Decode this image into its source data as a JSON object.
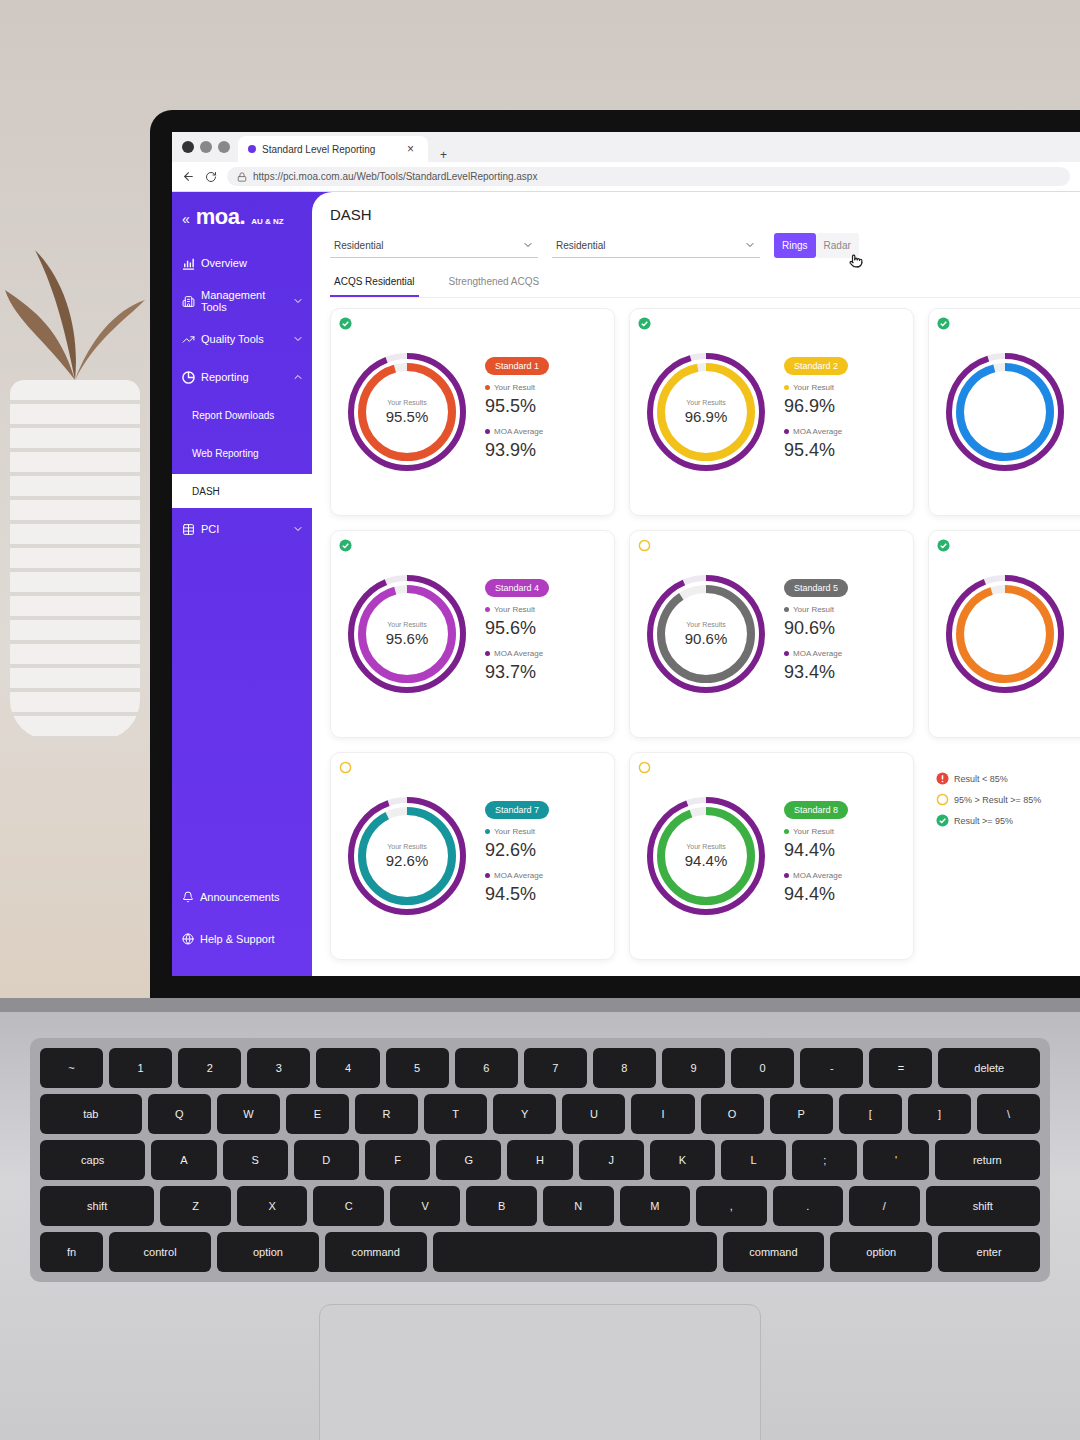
{
  "browser": {
    "tab_title": "Standard Level Reporting",
    "tab_close": "×",
    "new_tab": "+",
    "url": "https://pci.moa.com.au/Web/Tools/StandardLevelReporting.aspx"
  },
  "sidebar": {
    "collapse": "«",
    "logo": "moa.",
    "logo_region": "AU & NZ",
    "items": [
      {
        "label": "Overview",
        "kind": "section",
        "expandable": false,
        "expanded": false,
        "selected": false
      },
      {
        "label": "Management Tools",
        "kind": "section",
        "expandable": true,
        "expanded": false,
        "selected": false
      },
      {
        "label": "Quality Tools",
        "kind": "section",
        "expandable": true,
        "expanded": false,
        "selected": false
      },
      {
        "label": "Reporting",
        "kind": "section",
        "expandable": true,
        "expanded": true,
        "selected": false
      },
      {
        "label": "Report Downloads",
        "kind": "sub",
        "expandable": false,
        "expanded": false,
        "selected": false
      },
      {
        "label": "Web Reporting",
        "kind": "sub",
        "expandable": false,
        "expanded": false,
        "selected": false
      },
      {
        "label": "DASH",
        "kind": "sub",
        "expandable": false,
        "expanded": false,
        "selected": true
      },
      {
        "label": "PCI",
        "kind": "section",
        "expandable": true,
        "expanded": false,
        "selected": false
      }
    ],
    "footer": [
      {
        "label": "Announcements"
      },
      {
        "label": "Help & Support"
      }
    ]
  },
  "page": {
    "title": "DASH",
    "filters": [
      {
        "value": "Residential"
      },
      {
        "value": "Residential"
      }
    ],
    "view_toggle": [
      {
        "label": "Rings",
        "selected": true
      },
      {
        "label": "Radar",
        "selected": false
      }
    ],
    "tabs": [
      {
        "label": "ACQS Residential",
        "selected": true
      },
      {
        "label": "Strengthened ACQS",
        "selected": false
      }
    ]
  },
  "cards": [
    {
      "kind": "full",
      "badge": "Standard 1",
      "color": "#e4532b",
      "status_kind": "check",
      "status_color": "#27b36b",
      "center_label": "Your Results",
      "result": "95.5%",
      "result_label": "Your Result",
      "average_label": "MOA Average",
      "average": "93.9%",
      "result_level": 0.955,
      "average_level": 0.939
    },
    {
      "kind": "full",
      "badge": "Standard 2",
      "color": "#f2c21b",
      "status_kind": "check",
      "status_color": "#27b36b",
      "center_label": "Your Results",
      "result": "96.9%",
      "result_label": "Your Result",
      "average_label": "MOA Average",
      "average": "95.4%",
      "result_level": 0.969,
      "average_level": 0.954
    },
    {
      "kind": "partial",
      "color": "#1e88e5",
      "status_kind": "check",
      "status_color": "#27b36b",
      "result_level": 0.96,
      "average_level": 0.95
    },
    {
      "kind": "full",
      "badge": "Standard 4",
      "color": "#b03cc0",
      "status_kind": "check",
      "status_color": "#27b36b",
      "center_label": "Your Results",
      "result": "95.6%",
      "result_label": "Your Result",
      "average_label": "MOA Average",
      "average": "93.7%",
      "result_level": 0.956,
      "average_level": 0.937
    },
    {
      "kind": "full",
      "badge": "Standard 5",
      "color": "#6f6f6f",
      "status_kind": "ring",
      "status_color": "#f2c230",
      "center_label": "Your Results",
      "result": "90.6%",
      "result_label": "Your Result",
      "average_label": "MOA Average",
      "average": "93.4%",
      "result_level": 0.906,
      "average_level": 0.934
    },
    {
      "kind": "partial",
      "color": "#ef7d22",
      "status_kind": "check",
      "status_color": "#27b36b",
      "result_level": 0.95,
      "average_level": 0.94
    },
    {
      "kind": "full",
      "badge": "Standard 7",
      "color": "#17959c",
      "status_kind": "ring",
      "status_color": "#f2c230",
      "center_label": "Your Results",
      "result": "92.6%",
      "result_label": "Your Result",
      "average_label": "MOA Average",
      "average": "94.5%",
      "result_level": 0.926,
      "average_level": 0.945
    },
    {
      "kind": "full",
      "badge": "Standard 8",
      "color": "#3cb043",
      "status_kind": "ring",
      "status_color": "#f2c230",
      "center_label": "Your Results",
      "result": "94.4%",
      "result_label": "Your Result",
      "average_label": "MOA Average",
      "average": "94.4%",
      "result_level": 0.944,
      "average_level": 0.944
    }
  ],
  "legend": [
    {
      "label": "Result < 85%",
      "kind": "alert",
      "color": "#e5483a"
    },
    {
      "label": "95% > Result >= 85%",
      "kind": "ring",
      "color": "#f2c230"
    },
    {
      "label": "Result >= 95%",
      "kind": "check",
      "color": "#27b36b"
    }
  ],
  "keyboard": {
    "rows": [
      [
        "~",
        "1",
        "2",
        "3",
        "4",
        "5",
        "6",
        "7",
        "8",
        "9",
        "0",
        "-",
        "=",
        "delete"
      ],
      [
        "tab",
        "Q",
        "W",
        "E",
        "R",
        "T",
        "Y",
        "U",
        "I",
        "O",
        "P",
        "[",
        "]",
        "\\"
      ],
      [
        "caps",
        "A",
        "S",
        "D",
        "F",
        "G",
        "H",
        "J",
        "K",
        "L",
        ";",
        "'",
        "return"
      ],
      [
        "shift",
        "Z",
        "X",
        "C",
        "V",
        "B",
        "N",
        "M",
        ",",
        ".",
        "/",
        "shift"
      ],
      [
        "fn",
        "control",
        "option",
        "command",
        "",
        "command",
        "option",
        "enter"
      ]
    ]
  }
}
